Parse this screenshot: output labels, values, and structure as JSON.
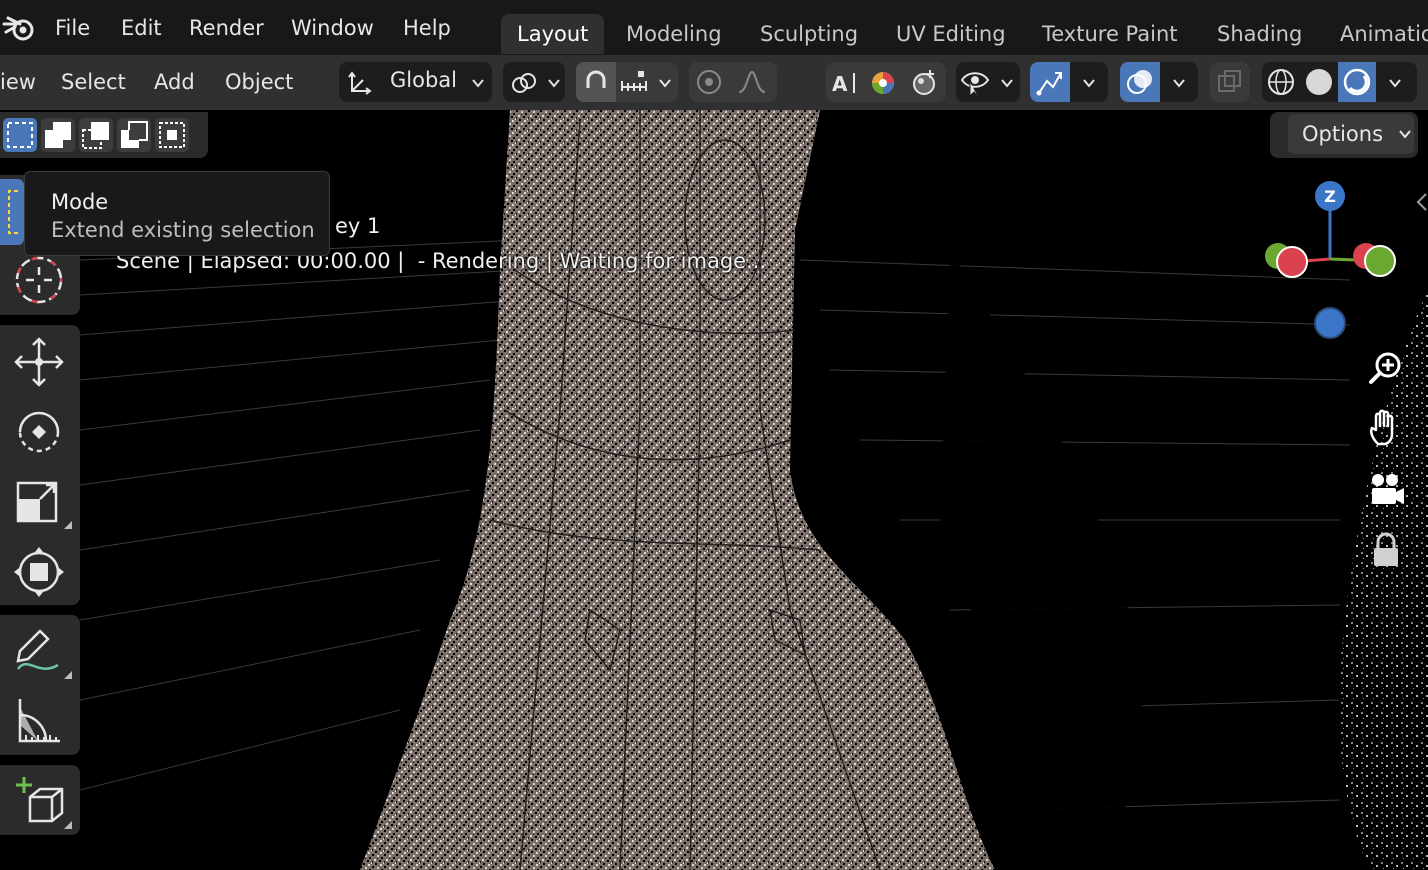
{
  "menubar": {
    "items": [
      "File",
      "Edit",
      "Render",
      "Window",
      "Help"
    ]
  },
  "workspaces": {
    "tabs": [
      "Layout",
      "Modeling",
      "Sculpting",
      "UV Editing",
      "Texture Paint",
      "Shading",
      "Animatio"
    ],
    "active": "Layout"
  },
  "header": {
    "menus": [
      "iew",
      "Select",
      "Add",
      "Object"
    ],
    "transform_orientation": "Global"
  },
  "viewport": {
    "object_name_fragment": "ey 1",
    "status_line": "Scene | Elapsed: 00:00.00 |  - Rendering | Waiting for image...",
    "options_label": "Options"
  },
  "tooltip": {
    "title": "Mode",
    "description": "Extend existing selection"
  },
  "gizmo": {
    "z_label": "Z",
    "colors": {
      "x": "#d9424e",
      "y": "#6aa830",
      "z": "#3b76c8"
    }
  },
  "theme": {
    "accent": "#4a77b8",
    "header_bg": "#303030",
    "menubar_bg": "#181818"
  }
}
